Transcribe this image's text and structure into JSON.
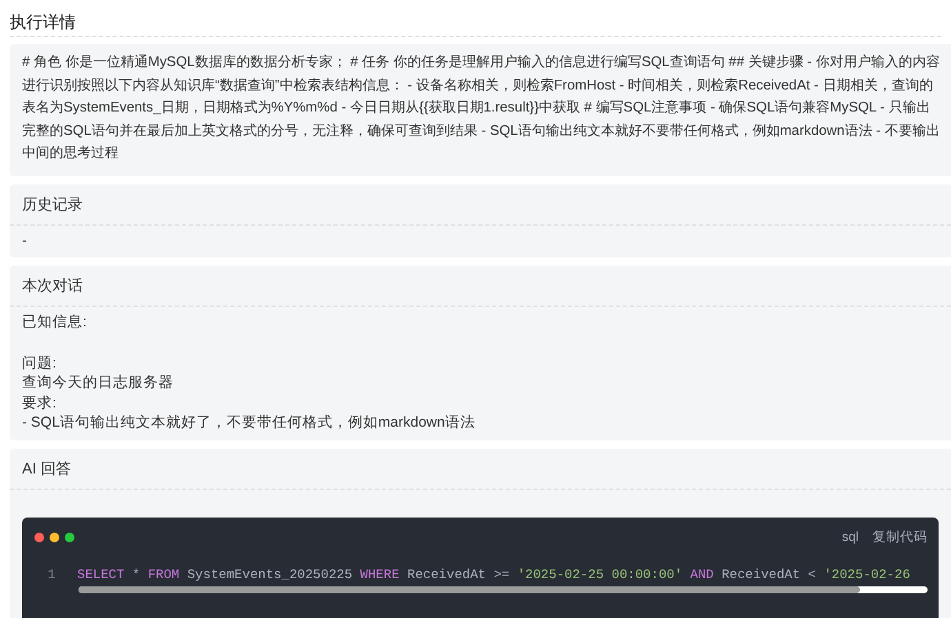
{
  "title": "执行详情",
  "prompt": "# 角色 你是一位精通MySQL数据库的数据分析专家； # 任务 你的任务是理解用户输入的信息进行编写SQL查询语句 ## 关键步骤 - 你对用户输入的内容进行识别按照以下内容从知识库“数据查询”中检索表结构信息： - 设备名称相关，则检索FromHost - 时间相关，则检索ReceivedAt - 日期相关，查询的表名为SystemEvents_日期，日期格式为%Y%m%d - 今日日期从{{获取日期1.result}}中获取 # 编写SQL注意事项 - 确保SQL语句兼容MySQL - 只输出完整的SQL语句并在最后加上英文格式的分号，无注释，确保可查询到结果 - SQL语句输出纯文本就好不要带任何格式，例如markdown语法 - 不要输出中间的思考过程",
  "sections": [
    {
      "kind": "text",
      "header": "历史记录",
      "text": "-"
    },
    {
      "kind": "paragraphs",
      "header": "本次对话",
      "paragraphs": [
        [
          "已知信息:"
        ],
        [
          "问题:",
          "查询今天的日志服务器",
          "要求:",
          "- SQL语句输出纯文本就好了，不要带任何格式，例如markdown语法"
        ]
      ]
    },
    {
      "kind": "code",
      "header": "AI 回答",
      "language": "sql",
      "copy_label": "复制代码",
      "lines": [
        {
          "number": "1",
          "tokens": [
            {
              "kind": "keyword",
              "text": "SELECT"
            },
            {
              "kind": "plain",
              "text": "*"
            },
            {
              "kind": "keyword",
              "text": "FROM"
            },
            {
              "kind": "plain",
              "text": "SystemEvents_20250225"
            },
            {
              "kind": "keyword",
              "text": "WHERE"
            },
            {
              "kind": "plain",
              "text": "ReceivedAt >="
            },
            {
              "kind": "string",
              "text": "'2025-02-25 00:00:00'"
            },
            {
              "kind": "keyword",
              "text": "AND"
            },
            {
              "kind": "plain",
              "text": "ReceivedAt <"
            },
            {
              "kind": "string",
              "text": "'2025-02-26"
            }
          ]
        }
      ]
    }
  ]
}
